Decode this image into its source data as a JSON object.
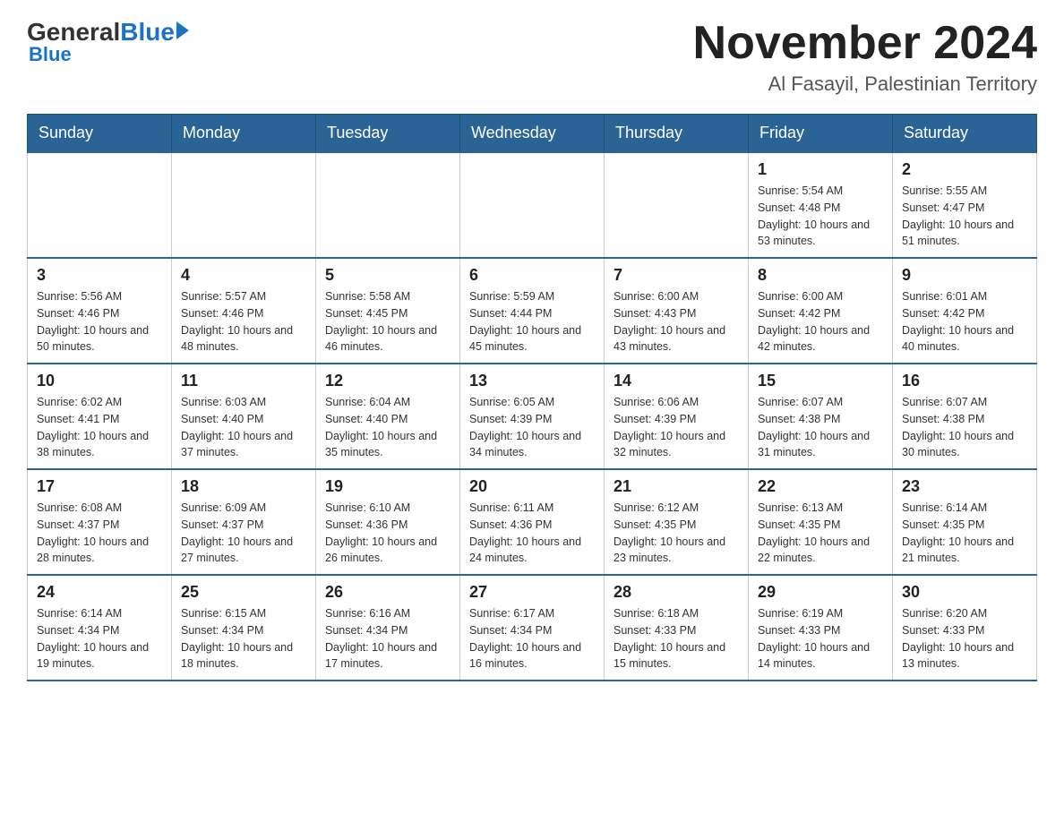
{
  "header": {
    "logo_general": "General",
    "logo_blue": "Blue",
    "month_title": "November 2024",
    "location": "Al Fasayil, Palestinian Territory"
  },
  "weekdays": [
    "Sunday",
    "Monday",
    "Tuesday",
    "Wednesday",
    "Thursday",
    "Friday",
    "Saturday"
  ],
  "weeks": [
    [
      {
        "day": "",
        "info": ""
      },
      {
        "day": "",
        "info": ""
      },
      {
        "day": "",
        "info": ""
      },
      {
        "day": "",
        "info": ""
      },
      {
        "day": "",
        "info": ""
      },
      {
        "day": "1",
        "info": "Sunrise: 5:54 AM\nSunset: 4:48 PM\nDaylight: 10 hours and 53 minutes."
      },
      {
        "day": "2",
        "info": "Sunrise: 5:55 AM\nSunset: 4:47 PM\nDaylight: 10 hours and 51 minutes."
      }
    ],
    [
      {
        "day": "3",
        "info": "Sunrise: 5:56 AM\nSunset: 4:46 PM\nDaylight: 10 hours and 50 minutes."
      },
      {
        "day": "4",
        "info": "Sunrise: 5:57 AM\nSunset: 4:46 PM\nDaylight: 10 hours and 48 minutes."
      },
      {
        "day": "5",
        "info": "Sunrise: 5:58 AM\nSunset: 4:45 PM\nDaylight: 10 hours and 46 minutes."
      },
      {
        "day": "6",
        "info": "Sunrise: 5:59 AM\nSunset: 4:44 PM\nDaylight: 10 hours and 45 minutes."
      },
      {
        "day": "7",
        "info": "Sunrise: 6:00 AM\nSunset: 4:43 PM\nDaylight: 10 hours and 43 minutes."
      },
      {
        "day": "8",
        "info": "Sunrise: 6:00 AM\nSunset: 4:42 PM\nDaylight: 10 hours and 42 minutes."
      },
      {
        "day": "9",
        "info": "Sunrise: 6:01 AM\nSunset: 4:42 PM\nDaylight: 10 hours and 40 minutes."
      }
    ],
    [
      {
        "day": "10",
        "info": "Sunrise: 6:02 AM\nSunset: 4:41 PM\nDaylight: 10 hours and 38 minutes."
      },
      {
        "day": "11",
        "info": "Sunrise: 6:03 AM\nSunset: 4:40 PM\nDaylight: 10 hours and 37 minutes."
      },
      {
        "day": "12",
        "info": "Sunrise: 6:04 AM\nSunset: 4:40 PM\nDaylight: 10 hours and 35 minutes."
      },
      {
        "day": "13",
        "info": "Sunrise: 6:05 AM\nSunset: 4:39 PM\nDaylight: 10 hours and 34 minutes."
      },
      {
        "day": "14",
        "info": "Sunrise: 6:06 AM\nSunset: 4:39 PM\nDaylight: 10 hours and 32 minutes."
      },
      {
        "day": "15",
        "info": "Sunrise: 6:07 AM\nSunset: 4:38 PM\nDaylight: 10 hours and 31 minutes."
      },
      {
        "day": "16",
        "info": "Sunrise: 6:07 AM\nSunset: 4:38 PM\nDaylight: 10 hours and 30 minutes."
      }
    ],
    [
      {
        "day": "17",
        "info": "Sunrise: 6:08 AM\nSunset: 4:37 PM\nDaylight: 10 hours and 28 minutes."
      },
      {
        "day": "18",
        "info": "Sunrise: 6:09 AM\nSunset: 4:37 PM\nDaylight: 10 hours and 27 minutes."
      },
      {
        "day": "19",
        "info": "Sunrise: 6:10 AM\nSunset: 4:36 PM\nDaylight: 10 hours and 26 minutes."
      },
      {
        "day": "20",
        "info": "Sunrise: 6:11 AM\nSunset: 4:36 PM\nDaylight: 10 hours and 24 minutes."
      },
      {
        "day": "21",
        "info": "Sunrise: 6:12 AM\nSunset: 4:35 PM\nDaylight: 10 hours and 23 minutes."
      },
      {
        "day": "22",
        "info": "Sunrise: 6:13 AM\nSunset: 4:35 PM\nDaylight: 10 hours and 22 minutes."
      },
      {
        "day": "23",
        "info": "Sunrise: 6:14 AM\nSunset: 4:35 PM\nDaylight: 10 hours and 21 minutes."
      }
    ],
    [
      {
        "day": "24",
        "info": "Sunrise: 6:14 AM\nSunset: 4:34 PM\nDaylight: 10 hours and 19 minutes."
      },
      {
        "day": "25",
        "info": "Sunrise: 6:15 AM\nSunset: 4:34 PM\nDaylight: 10 hours and 18 minutes."
      },
      {
        "day": "26",
        "info": "Sunrise: 6:16 AM\nSunset: 4:34 PM\nDaylight: 10 hours and 17 minutes."
      },
      {
        "day": "27",
        "info": "Sunrise: 6:17 AM\nSunset: 4:34 PM\nDaylight: 10 hours and 16 minutes."
      },
      {
        "day": "28",
        "info": "Sunrise: 6:18 AM\nSunset: 4:33 PM\nDaylight: 10 hours and 15 minutes."
      },
      {
        "day": "29",
        "info": "Sunrise: 6:19 AM\nSunset: 4:33 PM\nDaylight: 10 hours and 14 minutes."
      },
      {
        "day": "30",
        "info": "Sunrise: 6:20 AM\nSunset: 4:33 PM\nDaylight: 10 hours and 13 minutes."
      }
    ]
  ]
}
